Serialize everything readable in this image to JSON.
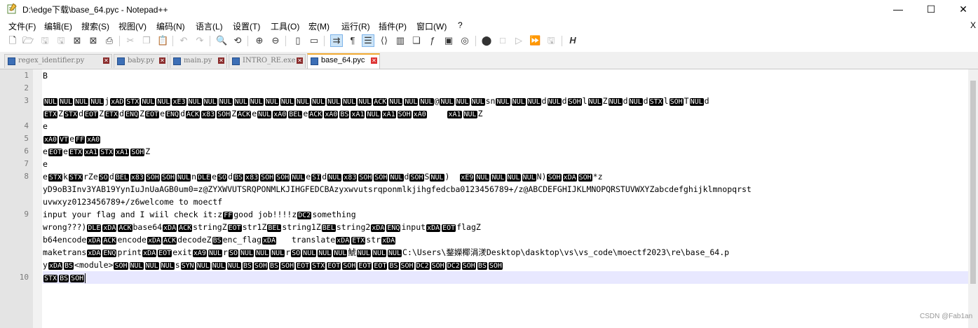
{
  "window": {
    "title": "D:\\edge下载\\base_64.pyc - Notepad++",
    "minimize": "—",
    "maximize": "☐",
    "close": "✕"
  },
  "menu": [
    "文件(F)",
    "编辑(E)",
    "搜索(S)",
    "视图(V)",
    "编码(N)",
    "语言(L)",
    "设置(T)",
    "工具(O)",
    "宏(M)",
    "运行(R)",
    "插件(P)",
    "窗口(W)",
    "?"
  ],
  "menu_close": "X",
  "tabs": [
    {
      "label": "regex_identifier.py"
    },
    {
      "label": "baby.py"
    },
    {
      "label": "main.py"
    },
    {
      "label": "INTRO_RE.exe"
    },
    {
      "label": "base_64.pyc"
    }
  ],
  "line_numbers": [
    "1",
    "2",
    "3",
    "4",
    "5",
    "6",
    "7",
    "8",
    "9",
    "10"
  ],
  "code": {
    "l1": "B",
    "l8b": "yD9oB3Inv3YAB19YynIuJnUaAGB0um0=z@ZYXWVUTSRQPONMLKJIHGFEDCBAzyxwvutsrqponmlkjihgfedcba0123456789+/z@ABCDEFGHIJKLMNOPQRSTUVWXYZabcdefghijklmnopqrst",
    "l8c": "uvwxyz0123456789+/z6welcome to moectf",
    "l9a_1": "input your flag and I wiil check it:z",
    "l9a_2": "good job!!!!z",
    "l9a_3": "something",
    "l9b_1": "wrong???)",
    "l9b_2": "base64",
    "l9b_3": "stringZ",
    "l9b_4": "str1Z",
    "l9b_5": "string1Z",
    "l9b_6": "string2",
    "l9b_7": "input",
    "l9b_8": "flagZ",
    "l9c_1": "b64encode",
    "l9c_2": "encode",
    "l9c_3": "decodeZ",
    "l9c_4": "enc_flag",
    "l9c_5": "   translate",
    "l9c_6": "str",
    "l9d_1": "maketrans",
    "l9d_2": "print",
    "l9d_3": "exit",
    "l9d_4": "C:\\Users\\鍪嬫椰涓湵Desktop\\dasktop\\vs\\vs_code\\moectf2023\\re\\base_64.p",
    "l9e_1": "y",
    "l9e_2": "<module>"
  },
  "watermark": "CSDN @Fab1an"
}
